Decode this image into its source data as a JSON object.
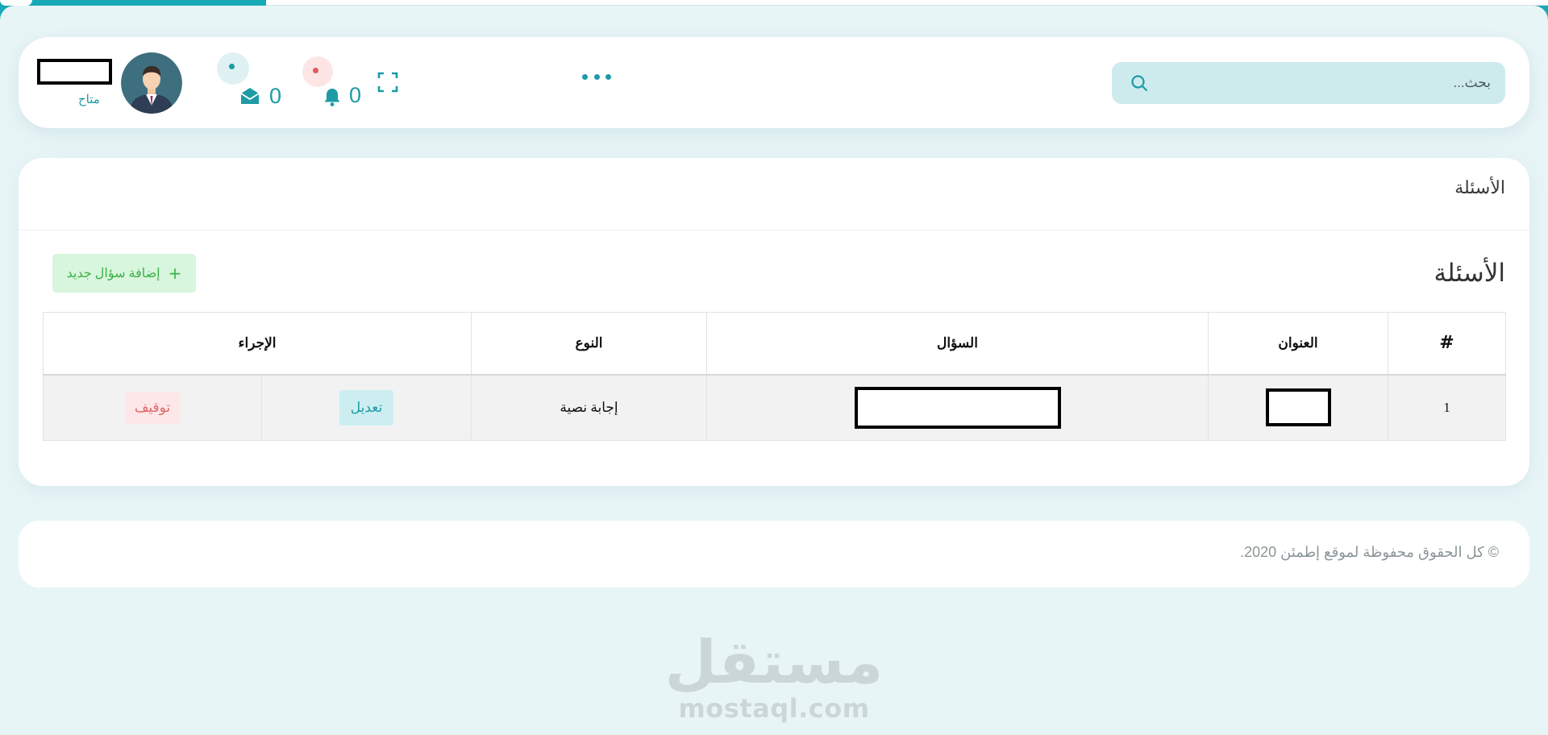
{
  "header": {
    "search_placeholder": "بحث...",
    "notifications_count": "0",
    "messages_count": "0",
    "user_status": "متاح"
  },
  "page": {
    "breadcrumb": "الأسئلة",
    "title": "الأسئلة",
    "add_button_label": "إضافة سؤال جديد"
  },
  "table": {
    "headers": [
      "#",
      "العنوان",
      "السؤال",
      "النوع",
      "الإجراء"
    ],
    "rows": [
      {
        "index": "1",
        "type": "إجابة نصية",
        "edit_label": "تعديل",
        "stop_label": "توقيف"
      }
    ]
  },
  "footer": {
    "copyright": "© كل الحقوق محفوظة لموقع إطمئن 2020."
  },
  "watermark": {
    "arabic": "مستقل",
    "latin": "mostaql.com"
  },
  "colors": {
    "accent": "#1d9ba6",
    "success": "#3cb148",
    "danger": "#e06666"
  },
  "icons": [
    "search-icon",
    "more-icon",
    "fullscreen-icon",
    "bell-icon",
    "mail-icon",
    "plus-icon"
  ]
}
